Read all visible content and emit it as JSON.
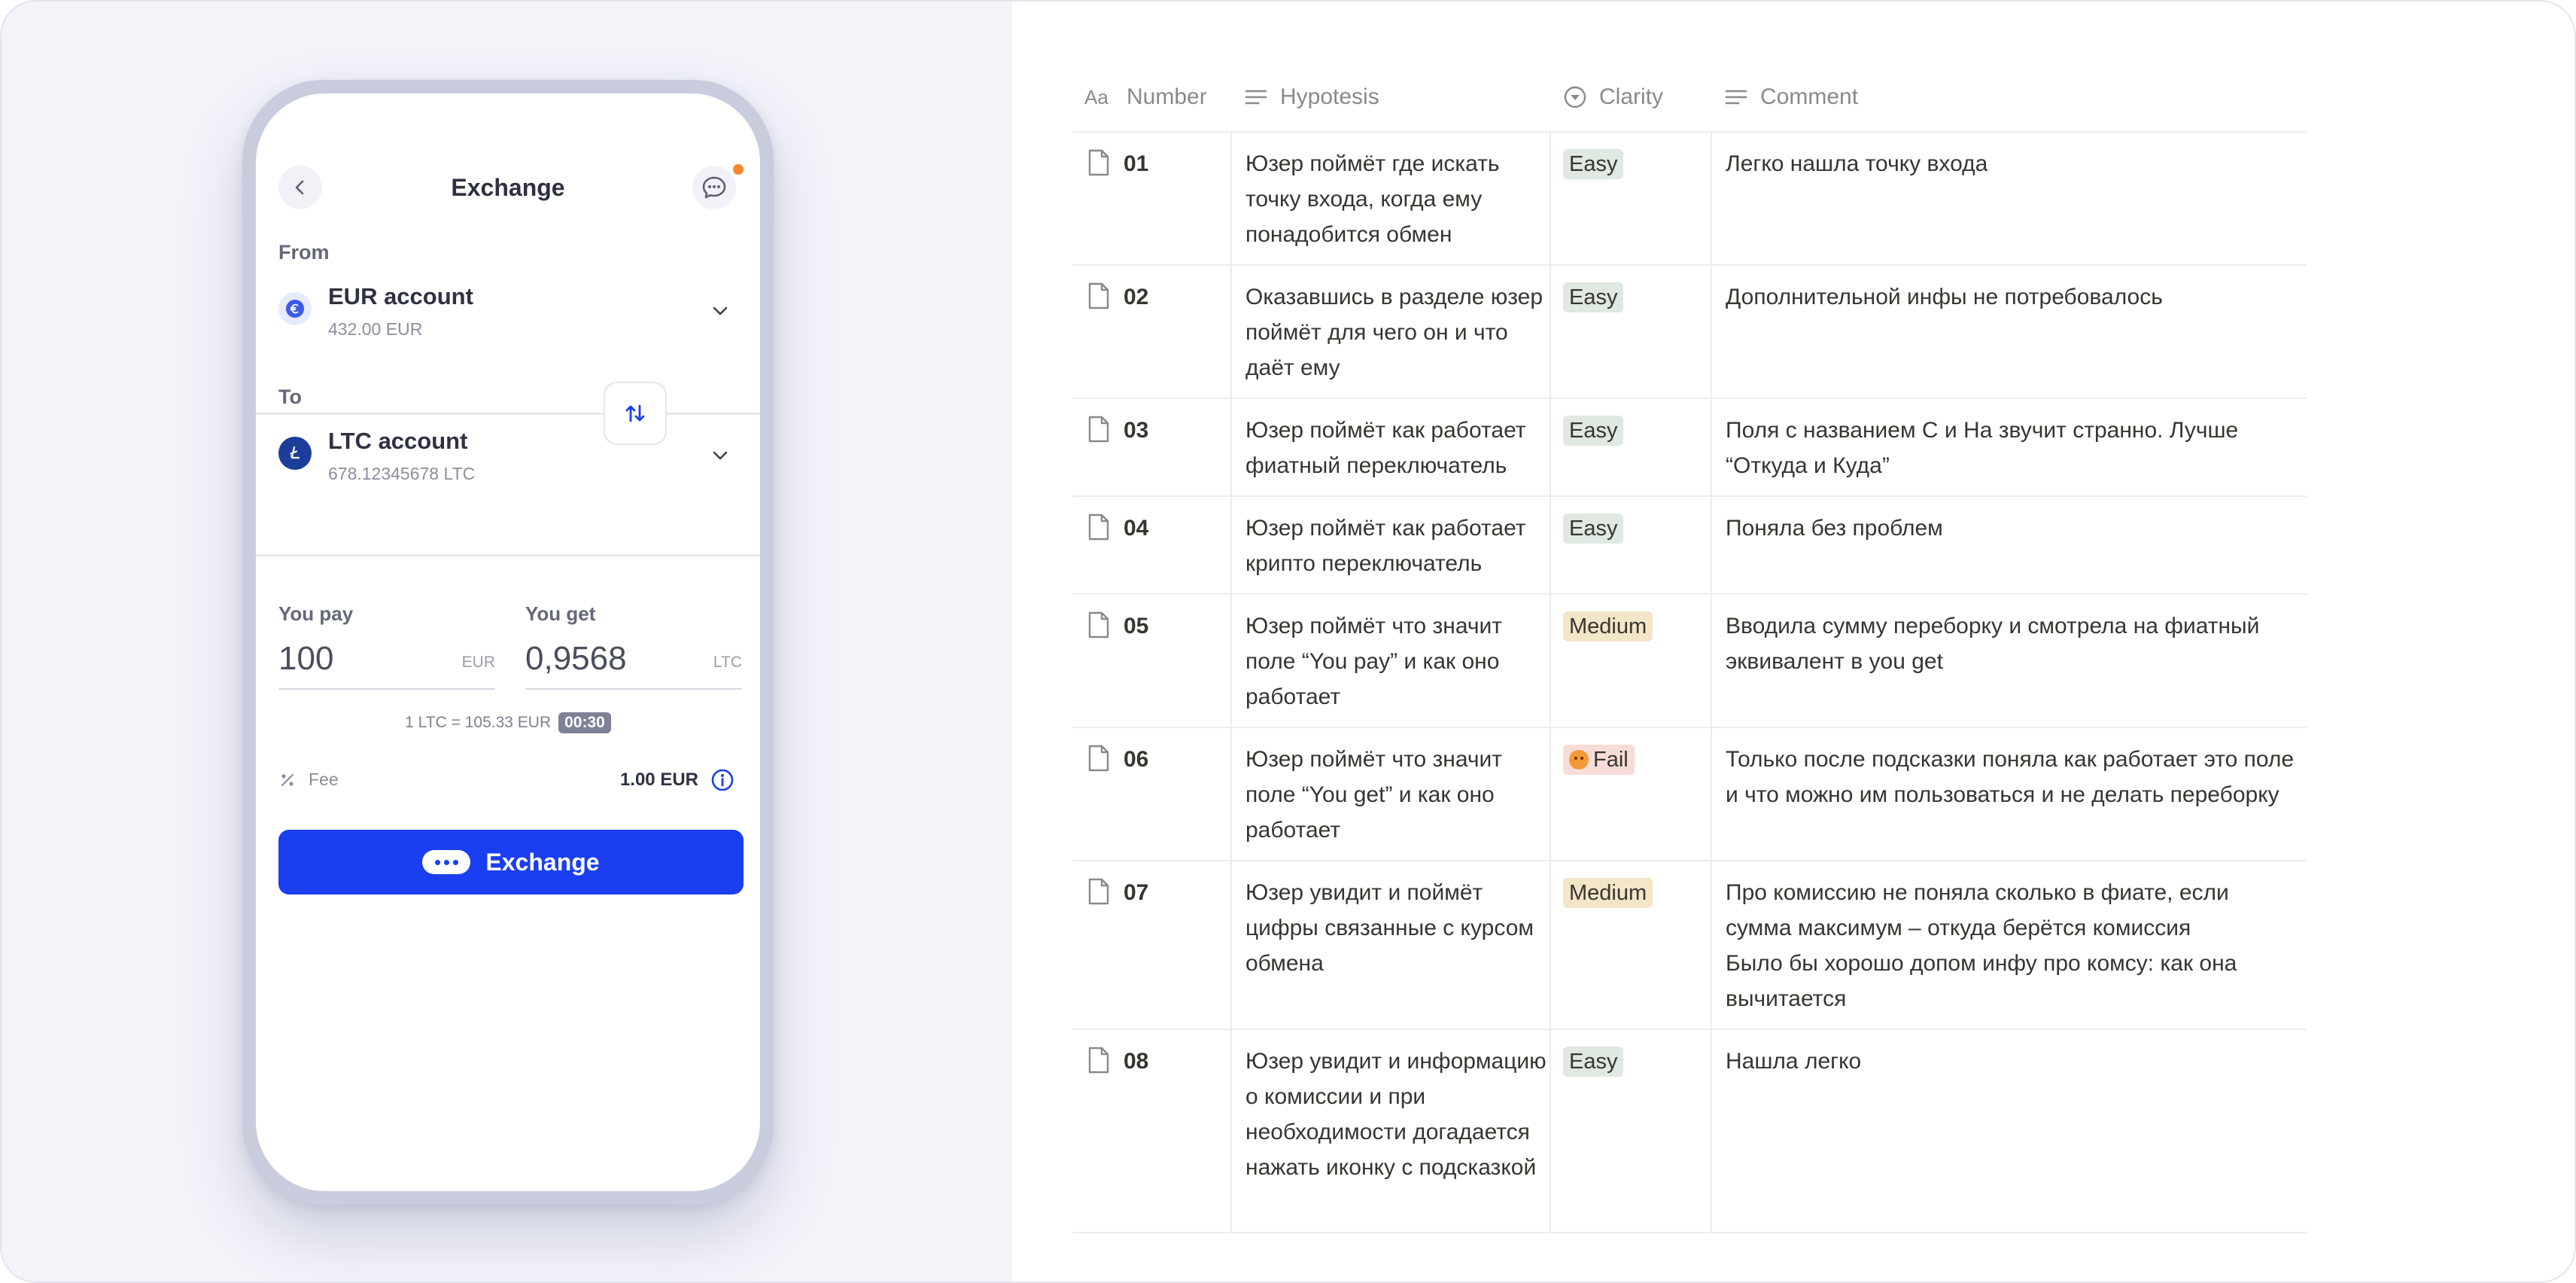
{
  "phone": {
    "title": "Exchange",
    "from_label": "From",
    "to_label": "To",
    "from_account": {
      "name": "EUR account",
      "balance": "432.00 EUR",
      "icon": "euro-icon",
      "color": "#3d5ae8"
    },
    "to_account": {
      "name": "LTC account",
      "balance": "678.12345678 LTC",
      "icon": "litecoin-icon",
      "color": "#1c3e9a"
    },
    "you_pay": {
      "label": "You pay",
      "value": "100",
      "currency": "EUR"
    },
    "you_get": {
      "label": "You get",
      "value": "0,9568",
      "currency": "LTC"
    },
    "rate": {
      "text": "1 LTC = 105.33 EUR",
      "timer": "00:30"
    },
    "fee": {
      "label": "Fee",
      "value": "1.00 EUR"
    },
    "exchange_button": "Exchange",
    "accent_color": "#1a3ff0",
    "notification_color": "#f7872e"
  },
  "table": {
    "headers": [
      {
        "label": "Number",
        "icon": "title-icon"
      },
      {
        "label": "Hypotesis",
        "icon": "text-icon"
      },
      {
        "label": "Clarity",
        "icon": "select-icon"
      },
      {
        "label": "Comment",
        "icon": "text-icon"
      }
    ],
    "rows": [
      {
        "number": "01",
        "hypothesis": "Юзер поймёт где искать точку входа, когда ему понадобится обмен",
        "clarity": "Easy",
        "comment": "Легко нашла точку входа"
      },
      {
        "number": "02",
        "hypothesis": "Оказавшись в разделе юзер поймёт для чего он и что даёт ему",
        "clarity": "Easy",
        "comment": "Дополнительной инфы не потребовалось"
      },
      {
        "number": "03",
        "hypothesis": "Юзер поймёт как работает фиатный переключатель",
        "clarity": "Easy",
        "comment": "Поля с названием С и На звучит странно. Лучше “Откуда и Куда”"
      },
      {
        "number": "04",
        "hypothesis": "Юзер поймёт как работает крипто переключатель",
        "clarity": "Easy",
        "comment": "Поняла без проблем"
      },
      {
        "number": "05",
        "hypothesis": "Юзер поймёт что значит поле “You pay” и как оно работает",
        "clarity": "Medium",
        "comment": "Вводила сумму переборку и смотрела на фиатный эквивалент в you get"
      },
      {
        "number": "06",
        "hypothesis": "Юзер поймёт что значит поле “You get” и как оно работает",
        "clarity": "Fail",
        "comment": "Только после подсказки поняла как работает это поле и что можно им пользоваться и не делать переборку"
      },
      {
        "number": "07",
        "hypothesis": "Юзер увидит и поймёт цифры связанные с курсом обмена",
        "clarity": "Medium",
        "comment": "Про комиссию не поняла сколько в фиате, если сумма максимум – откуда берётся комиссия\nБыло бы хорошо допом инфу про комсу: как она вычитается"
      },
      {
        "number": "08",
        "hypothesis": "Юзер увидит и информацию о комиссии и при необходимости догадается нажать иконку с подсказкой",
        "clarity": "Easy",
        "comment": "Нашла легко"
      }
    ],
    "tag_colors": {
      "Easy": "#dfe8e1",
      "Medium": "#f3e5c8",
      "Fail": "#f8dcd7"
    }
  }
}
